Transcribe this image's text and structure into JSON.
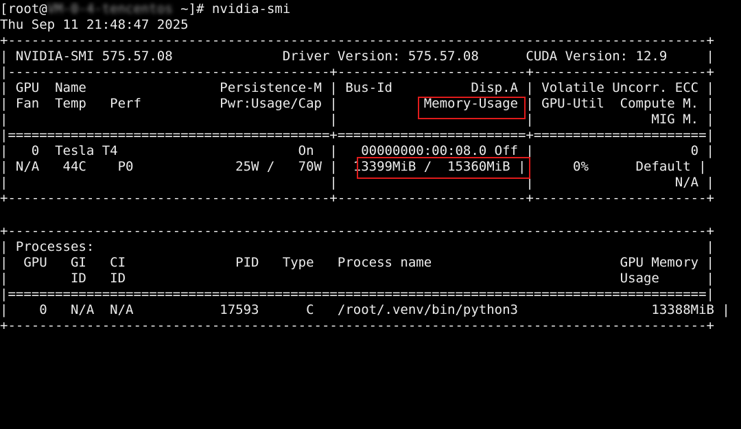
{
  "prompt": {
    "prefix": "[root@",
    "host": "VM-0-4-tencentos",
    "suffix": " ~]# ",
    "command": "nvidia-smi"
  },
  "timestamp": "Thu Sep 11 21:48:47 2025",
  "lines": {
    "border_top": "+-----------------------------------------------------------------------------------------+",
    "header": "| NVIDIA-SMI 575.57.08              Driver Version: 575.57.08      CUDA Version: 12.9     |",
    "sep1": "|-----------------------------------------+------------------------+----------------------+",
    "col_row1": "| GPU  Name                 Persistence-M | Bus-Id          Disp.A | Volatile Uncorr. ECC |",
    "col_row2": "| Fan  Temp   Perf          Pwr:Usage/Cap |           Memory-Usage | GPU-Util  Compute M. |",
    "col_row3": "|                                         |                        |               MIG M. |",
    "sep2": "|=========================================+========================+======================|",
    "gpu_row1": "|   0  Tesla T4                       On  |   00000000:00:08.0 Off |                    0 |",
    "gpu_row2": "| N/A   44C    P0             25W /   70W |  13399MiB /  15360MiB |      0%      Default |",
    "gpu_row3": "|                                         |                        |                  N/A |",
    "border_mid": "+-----------------------------------------+------------------------+----------------------+",
    "blank": "",
    "proc_top": "+-----------------------------------------------------------------------------------------+",
    "proc_title": "| Processes:                                                                              |",
    "proc_hdr1": "|  GPU   GI   CI              PID   Type   Process name                        GPU Memory |",
    "proc_hdr2": "|        ID   ID                                                               Usage      |",
    "proc_sep": "|=========================================================================================|",
    "proc_row": "|    0   N/A  N/A           17593      C   /root/.venv/bin/python3                 13388MiB |",
    "proc_bottom": "+-----------------------------------------------------------------------------------------+"
  },
  "colors": {
    "background": "#000000",
    "text": "#ececec",
    "highlight": "#e11b1b"
  }
}
